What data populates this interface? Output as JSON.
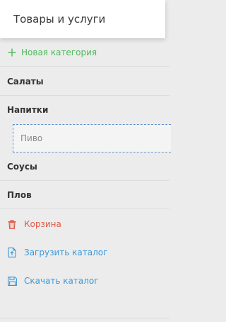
{
  "header": {
    "title": "Товары и услуги"
  },
  "new_category": {
    "label": "Новая категория",
    "icon": "plus-icon",
    "color": "#4cba5a"
  },
  "categories": [
    {
      "label": "Салаты"
    },
    {
      "label": "Напитки",
      "children": [
        {
          "label": "Пиво"
        }
      ]
    },
    {
      "label": "Соусы"
    },
    {
      "label": "Плов"
    }
  ],
  "actions": {
    "trash": {
      "label": "Корзина",
      "icon": "trash-icon",
      "color": "#e05a48"
    },
    "upload": {
      "label": "Загрузить каталог",
      "icon": "upload-file-icon",
      "color": "#3a98d8"
    },
    "download": {
      "label": "Скачать каталог",
      "icon": "save-icon",
      "color": "#3a98d8"
    }
  }
}
